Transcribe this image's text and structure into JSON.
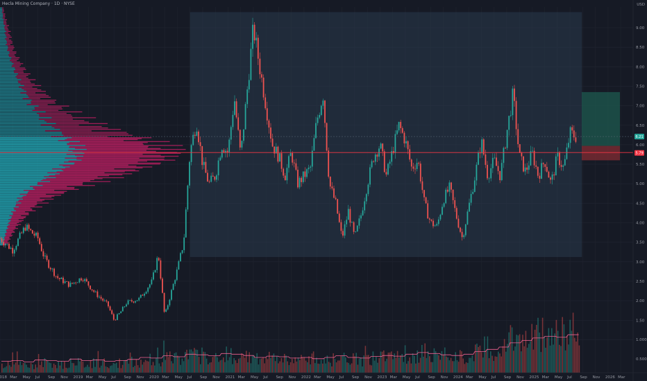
{
  "header": {
    "title": "Hecla Mining Company · 1D · NYSE",
    "currency": "USD"
  },
  "colors": {
    "background": "#161a25",
    "up": "#26a69a",
    "down": "#ef5350",
    "poc_line": "#f23645",
    "profile_teal": "#21a3b0",
    "profile_pink": "#b51f5f",
    "range_box": "#2a3b4d",
    "target_zone": "#1e5a4f",
    "stop_zone": "#7c2a32",
    "volume_ma": "#f06292"
  },
  "chart_data": {
    "type": "candlestick",
    "title": "Hecla Mining Company · 1D · NYSE",
    "ylabel": "USD",
    "ylim": [
      0.42,
      9.8
    ],
    "y_ticks": [
      "9.00",
      "8.50",
      "8.00",
      "7.50",
      "7.00",
      "6.50",
      "6.00",
      "5.50",
      "5.00",
      "4.50",
      "4.00",
      "3.50",
      "3.00",
      "2.50",
      "2.00",
      "1.50",
      "1.000",
      "0.5000"
    ],
    "x_ticks": [
      "2018",
      "Mar",
      "May",
      "Jul",
      "Sep",
      "Nov",
      "2019",
      "Mar",
      "May",
      "Jul",
      "Sep",
      "Nov",
      "2020",
      "Mar",
      "May",
      "Jul",
      "Sep",
      "Nov",
      "2021",
      "Mar",
      "May",
      "Jul",
      "Sep",
      "Nov",
      "2022",
      "Mar",
      "May",
      "Jul",
      "Sep",
      "Nov",
      "2023",
      "Mar",
      "May",
      "Jul",
      "Sep",
      "Nov",
      "2024",
      "Mar",
      "May",
      "Jul",
      "Sep",
      "Nov",
      "2025",
      "Mar",
      "May",
      "Jul",
      "Sep",
      "Nov",
      "2026",
      "Mar"
    ],
    "price_path": [
      [
        "2018-01",
        3.6
      ],
      [
        "2018-03",
        3.3
      ],
      [
        "2018-05",
        3.9
      ],
      [
        "2018-07",
        3.6
      ],
      [
        "2018-08",
        3.1
      ],
      [
        "2018-10",
        2.6
      ],
      [
        "2018-12",
        2.4
      ],
      [
        "2019-02",
        2.6
      ],
      [
        "2019-04",
        2.2
      ],
      [
        "2019-06",
        1.9
      ],
      [
        "2019-07",
        1.5
      ],
      [
        "2019-08",
        1.7
      ],
      [
        "2019-09",
        1.95
      ],
      [
        "2019-11",
        2.05
      ],
      [
        "2020-01",
        2.5
      ],
      [
        "2020-02",
        3.2
      ],
      [
        "2020-03",
        1.6
      ],
      [
        "2020-05",
        2.8
      ],
      [
        "2020-06",
        3.5
      ],
      [
        "2020-07",
        5.8
      ],
      [
        "2020-08",
        6.6
      ],
      [
        "2020-09",
        5.5
      ],
      [
        "2020-10",
        5.0
      ],
      [
        "2020-11",
        5.2
      ],
      [
        "2020-12",
        6.0
      ],
      [
        "2021-01",
        5.8
      ],
      [
        "2021-02",
        7.2
      ],
      [
        "2021-03",
        5.7
      ],
      [
        "2021-05",
        9.0
      ],
      [
        "2021-06",
        8.0
      ],
      [
        "2021-07",
        7.0
      ],
      [
        "2021-08",
        6.0
      ],
      [
        "2021-09",
        5.7
      ],
      [
        "2021-10",
        5.2
      ],
      [
        "2021-11",
        5.8
      ],
      [
        "2021-12",
        5.0
      ],
      [
        "2022-02",
        5.4
      ],
      [
        "2022-03",
        6.6
      ],
      [
        "2022-04",
        7.3
      ],
      [
        "2022-05",
        5.0
      ],
      [
        "2022-06",
        4.5
      ],
      [
        "2022-07",
        3.6
      ],
      [
        "2022-08",
        4.3
      ],
      [
        "2022-09",
        3.6
      ],
      [
        "2022-10",
        4.2
      ],
      [
        "2022-11",
        5.0
      ],
      [
        "2022-12",
        5.7
      ],
      [
        "2023-01",
        6.0
      ],
      [
        "2023-02",
        5.2
      ],
      [
        "2023-04",
        6.5
      ],
      [
        "2023-05",
        6.1
      ],
      [
        "2023-06",
        5.4
      ],
      [
        "2023-07",
        5.6
      ],
      [
        "2023-08",
        4.5
      ],
      [
        "2023-09",
        4.0
      ],
      [
        "2023-10",
        3.9
      ],
      [
        "2023-11",
        4.6
      ],
      [
        "2023-12",
        4.9
      ],
      [
        "2024-01",
        4.2
      ],
      [
        "2024-02",
        3.6
      ],
      [
        "2024-03",
        4.4
      ],
      [
        "2024-04",
        5.2
      ],
      [
        "2024-05",
        6.1
      ],
      [
        "2024-06",
        5.2
      ],
      [
        "2024-07",
        5.6
      ],
      [
        "2024-08",
        5.2
      ],
      [
        "2024-09",
        6.3
      ],
      [
        "2024-10",
        7.3
      ],
      [
        "2024-11",
        5.7
      ],
      [
        "2024-12",
        5.3
      ],
      [
        "2025-01",
        5.8
      ],
      [
        "2025-02",
        5.2
      ],
      [
        "2025-03",
        5.6
      ],
      [
        "2025-04",
        5.0
      ],
      [
        "2025-05",
        5.7
      ],
      [
        "2025-06",
        5.4
      ],
      [
        "2025-07",
        6.3
      ],
      [
        "2025-08",
        6.2
      ]
    ],
    "price_labels": [
      {
        "value": 6.21,
        "label": "6.21",
        "color": "#26a69a"
      },
      {
        "value": 5.79,
        "label": "5.79",
        "color": "#f23645"
      }
    ],
    "position_tool": {
      "entry": 5.97,
      "target": 7.35,
      "stop": 5.6,
      "entry_label": "7.35",
      "stop_label": "5.65"
    },
    "range_box": {
      "from": "2020-07",
      "to": "2025-08",
      "high": 9.4,
      "low": 3.12
    },
    "poc": 5.8,
    "volume_profile": {
      "price_rows": [
        9.5,
        9.2,
        8.9,
        8.6,
        8.3,
        8.0,
        7.7,
        7.4,
        7.1,
        6.8,
        6.5,
        6.2,
        6.0,
        5.8,
        5.6,
        5.4,
        5.2,
        5.0,
        4.8,
        4.6,
        4.4,
        4.2,
        4.0,
        3.8,
        3.6,
        3.4
      ],
      "up_volume": [
        3,
        5,
        8,
        10,
        14,
        20,
        27,
        35,
        45,
        60,
        75,
        95,
        110,
        118,
        112,
        95,
        78,
        60,
        42,
        30,
        24,
        18,
        14,
        10,
        7,
        4
      ],
      "down_volume": [
        2,
        4,
        6,
        8,
        10,
        14,
        18,
        25,
        35,
        48,
        70,
        105,
        125,
        135,
        128,
        112,
        95,
        72,
        55,
        40,
        30,
        22,
        16,
        12,
        8,
        5
      ]
    },
    "volume": {
      "ma_note": "",
      "levels": [
        0.18,
        0.2,
        0.16,
        0.22,
        0.2,
        0.18,
        0.25,
        0.2,
        0.22,
        0.18,
        0.2,
        0.24,
        0.3,
        0.28,
        0.35,
        0.32,
        0.4,
        0.38,
        0.35,
        0.42,
        0.4,
        0.36,
        0.3,
        0.34,
        0.32,
        0.28,
        0.3,
        0.26,
        0.3,
        0.35,
        0.3,
        0.28,
        0.33,
        0.36,
        0.34,
        0.4,
        0.45,
        0.42,
        0.38,
        0.36,
        0.4,
        0.48,
        0.55,
        0.62,
        0.75,
        0.82,
        0.9,
        0.95,
        0.92,
        1.0
      ]
    }
  }
}
